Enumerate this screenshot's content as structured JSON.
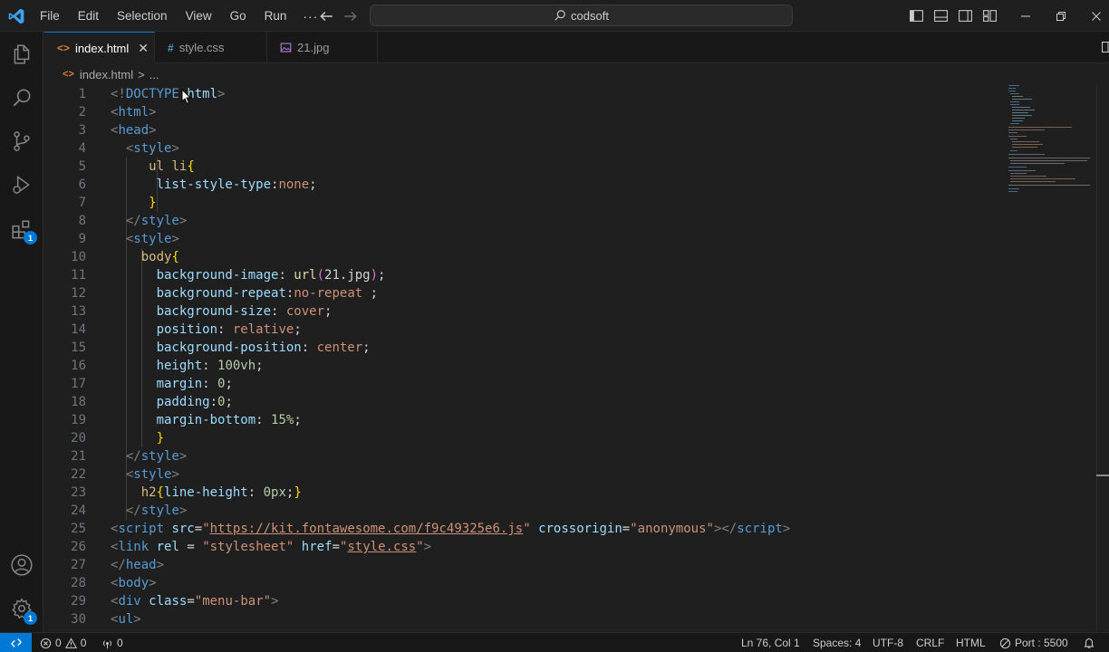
{
  "menu": {
    "items": [
      "File",
      "Edit",
      "Selection",
      "View",
      "Go",
      "Run"
    ],
    "more": "···"
  },
  "search": {
    "text": "codsoft"
  },
  "tabs": [
    {
      "label": "index.html",
      "icon": "<>",
      "icon_color": "#e37933",
      "active": true,
      "close": "✕"
    },
    {
      "label": "style.css",
      "icon": "#",
      "icon_color": "#519aba",
      "active": false
    },
    {
      "label": "21.jpg",
      "icon": "image-icon",
      "icon_color": "#a074c4",
      "active": false
    }
  ],
  "breadcrumb": {
    "file": "index.html",
    "separator": ">",
    "rest": "..."
  },
  "activity": {
    "extensions_badge": "1",
    "settings_badge": "1"
  },
  "editor": {
    "line_numbers": [
      "1",
      "2",
      "3",
      "4",
      "5",
      "6",
      "7",
      "8",
      "9",
      "10",
      "11",
      "12",
      "13",
      "14",
      "15",
      "16",
      "17",
      "18",
      "19",
      "20",
      "21",
      "22",
      "23",
      "24",
      "25",
      "26",
      "27",
      "28",
      "29",
      "30"
    ]
  },
  "status": {
    "errors": "0",
    "warnings": "0",
    "ports": "0",
    "position": "Ln 76, Col 1",
    "spaces": "Spaces: 4",
    "encoding": "UTF-8",
    "eol": "CRLF",
    "language": "HTML",
    "port": "Port : 5500"
  },
  "colors": {
    "accent": "#0078d4",
    "background": "#1f1f1f",
    "tag": "#569cd6",
    "attribute": "#9cdcfe",
    "string": "#ce9178",
    "number": "#b5cea8"
  }
}
